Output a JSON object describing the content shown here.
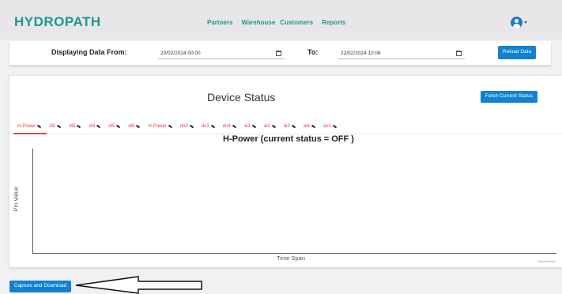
{
  "header": {
    "brand": "HYDROPATH",
    "nav": [
      "Partners",
      "Warehouse",
      "Customers",
      "Reports"
    ]
  },
  "filter": {
    "from_label": "Displaying Data From:",
    "from_value": "20/02/2024 00:00",
    "to_label": "To:",
    "to_value": "22/02/2024 10:06",
    "reload_label": "Reload Data"
  },
  "device": {
    "title": "Device Status",
    "fetch_label": "Fetch Current Status",
    "tabs": [
      "H-Power",
      "di2",
      "di3",
      "di4",
      "di5",
      "di6",
      "H-Power",
      "do2",
      "do3",
      "do4",
      "ai1",
      "ai2",
      "ai3",
      "ai4",
      "ao1"
    ],
    "active_tab": 0
  },
  "chart_data": {
    "type": "line",
    "title": "H-Power (current status = OFF )",
    "xlabel": "Time Span",
    "ylabel": "Pin Value",
    "series": [],
    "credit": "CanvasJS.com"
  },
  "footer": {
    "capture_label": "Capture and Download"
  },
  "colors": {
    "brand": "#1b9a8a",
    "button": "#1181d1",
    "tab": "#e0454c"
  }
}
